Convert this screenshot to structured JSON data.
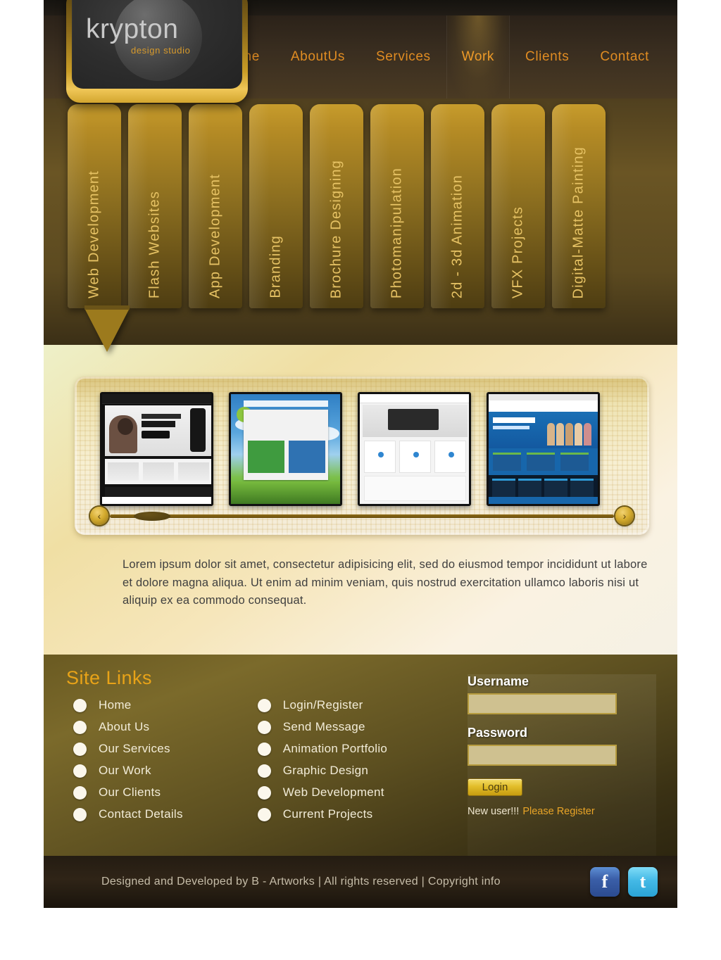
{
  "brand": {
    "name": "krypton",
    "tagline": "design studio"
  },
  "nav": {
    "items": [
      {
        "label": "Home",
        "active": false
      },
      {
        "label": "AboutUs",
        "active": false
      },
      {
        "label": "Services",
        "active": false
      },
      {
        "label": "Work",
        "active": true
      },
      {
        "label": "Clients",
        "active": false
      },
      {
        "label": "Contact",
        "active": false
      }
    ]
  },
  "service_tabs": {
    "active_index": 0,
    "items": [
      {
        "label": "Web Development"
      },
      {
        "label": "Flash Websites"
      },
      {
        "label": "App Development"
      },
      {
        "label": "Branding"
      },
      {
        "label": "Brochure Designing"
      },
      {
        "label": "Photomanipulation"
      },
      {
        "label": "2d - 3d Animation"
      },
      {
        "label": "VFX Projects"
      },
      {
        "label": "Digital-Matte Painting"
      }
    ]
  },
  "carousel": {
    "prev_label": "‹",
    "next_label": "›",
    "thumbnails": [
      {
        "name": "amazing-iphone-app-site"
      },
      {
        "name": "whats-your-sport-site"
      },
      {
        "name": "brightlife-corporate-site"
      },
      {
        "name": "university-scholarship-site"
      }
    ]
  },
  "content": {
    "description": "Lorem ipsum dolor sit amet, consectetur adipisicing elit, sed do eiusmod tempor incididunt ut labore et dolore magna aliqua. Ut enim ad minim veniam, quis nostrud exercitation ullamco laboris nisi ut aliquip ex ea commodo consequat."
  },
  "footer": {
    "title": "Site Links",
    "columns": [
      {
        "items": [
          {
            "label": "Home"
          },
          {
            "label": "About Us"
          },
          {
            "label": "Our Services"
          },
          {
            "label": "Our Work"
          },
          {
            "label": "Our Clients"
          },
          {
            "label": "Contact Details"
          }
        ]
      },
      {
        "items": [
          {
            "label": "Login/Register"
          },
          {
            "label": "Send Message"
          },
          {
            "label": "Animation Portfolio"
          },
          {
            "label": "Graphic Design"
          },
          {
            "label": "Web Development"
          },
          {
            "label": "Current Projects"
          }
        ]
      }
    ],
    "login": {
      "username_label": "Username",
      "username_value": "",
      "password_label": "Password",
      "password_value": "",
      "button_label": "Login",
      "newuser_text": "New user!!!",
      "register_link": "Please Register"
    },
    "copyright": "Designed and Developed by B - Artworks | All rights reserved | Copyright info",
    "socials": [
      {
        "name": "facebook",
        "glyph": "f"
      },
      {
        "name": "twitter",
        "glyph": "t"
      }
    ]
  },
  "colors": {
    "accent_orange": "#e08c22",
    "gold": "#c79c2c",
    "site_links_heading": "#e8a318",
    "facebook": "#3b5fa9",
    "twitter": "#44b9e6"
  }
}
